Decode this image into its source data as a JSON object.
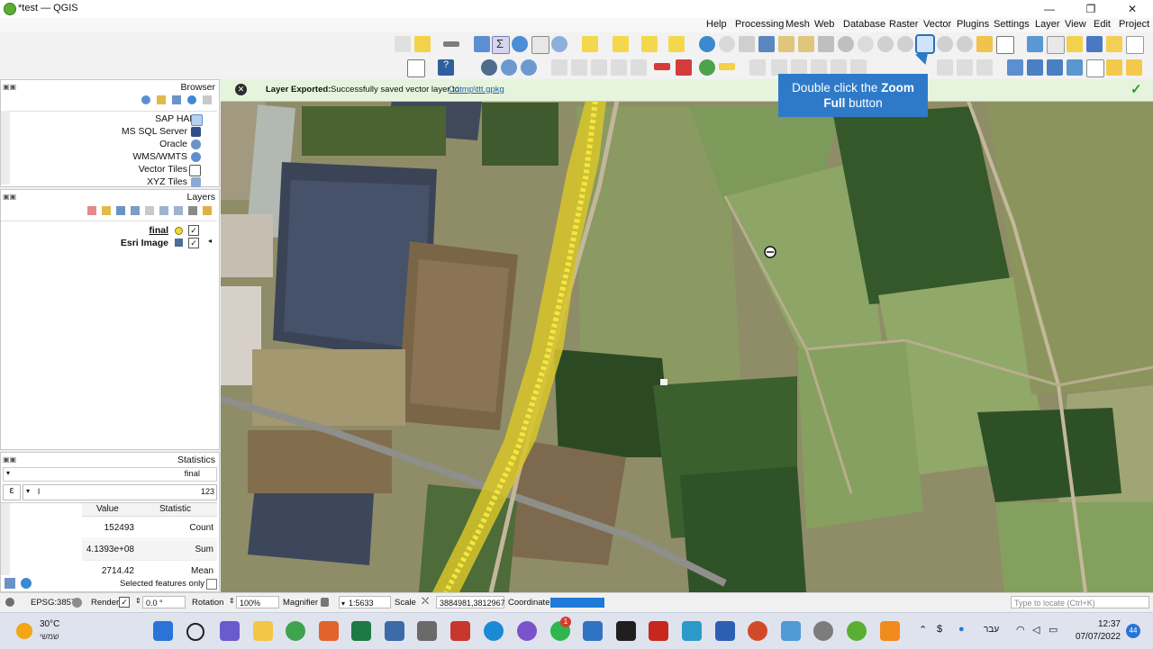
{
  "window": {
    "title": "*test — QGIS",
    "controls": [
      "—",
      "❐",
      "✕"
    ]
  },
  "menu": [
    "Help",
    "Processing",
    "Mesh",
    "Web",
    "Database",
    "Raster",
    "Vector",
    "Plugins",
    "Settings",
    "Layer",
    "View",
    "Edit",
    "Project"
  ],
  "message": {
    "title": "Layer Exported:",
    "text": "Successfully saved vector layer to",
    "link": "C:\\tmp\\ttt.gpkg"
  },
  "callout": {
    "prefix": "Double click the",
    "bold1": "Zoom",
    "bold2": "Full",
    "suffix": "button"
  },
  "browser": {
    "title": "Browser",
    "items": [
      {
        "label": "SAP HANA",
        "icon": "sap-hana-icon"
      },
      {
        "label": "MS SQL Server",
        "icon": "mssql-icon"
      },
      {
        "label": "Oracle",
        "icon": "oracle-icon"
      },
      {
        "label": "WMS/WMTS",
        "icon": "globe-icon"
      },
      {
        "label": "Vector Tiles",
        "icon": "vector-tiles-icon"
      },
      {
        "label": "XYZ Tiles",
        "icon": "xyz-tiles-icon"
      }
    ]
  },
  "layers": {
    "title": "Layers",
    "items": [
      {
        "label": "final",
        "checked": "✓"
      },
      {
        "label": "Esri Image",
        "checked": "✓"
      }
    ]
  },
  "statistics": {
    "title": "Statistics",
    "layer": "final",
    "field": "l",
    "count": "123",
    "headers": [
      "Value",
      "Statistic"
    ],
    "rows": [
      {
        "value": "152493",
        "stat": "Count"
      },
      {
        "value": "4.1393e+08",
        "stat": "Sum"
      },
      {
        "value": "2714.42",
        "stat": "Mean"
      }
    ],
    "selected_only": "Selected features only"
  },
  "status": {
    "crs": "EPSG:3857",
    "render": "Render",
    "rotation_label": "Rotation",
    "rotation": "0.0 °",
    "magnifier_label": "Magnifier",
    "magnifier": "100%",
    "scale_label": "Scale",
    "scale": "1:5633",
    "coordinate_label": "Coordinate",
    "coordinate": "3884981,3812967",
    "locate_placeholder": "Type to locate (Ctrl+K)"
  },
  "taskbar": {
    "temperature": "30°C",
    "weather": "שמשי",
    "language": "עבר",
    "time": "12:37",
    "date": "07/07/2022",
    "notifications": "44",
    "whatsapp_badge": "1"
  }
}
